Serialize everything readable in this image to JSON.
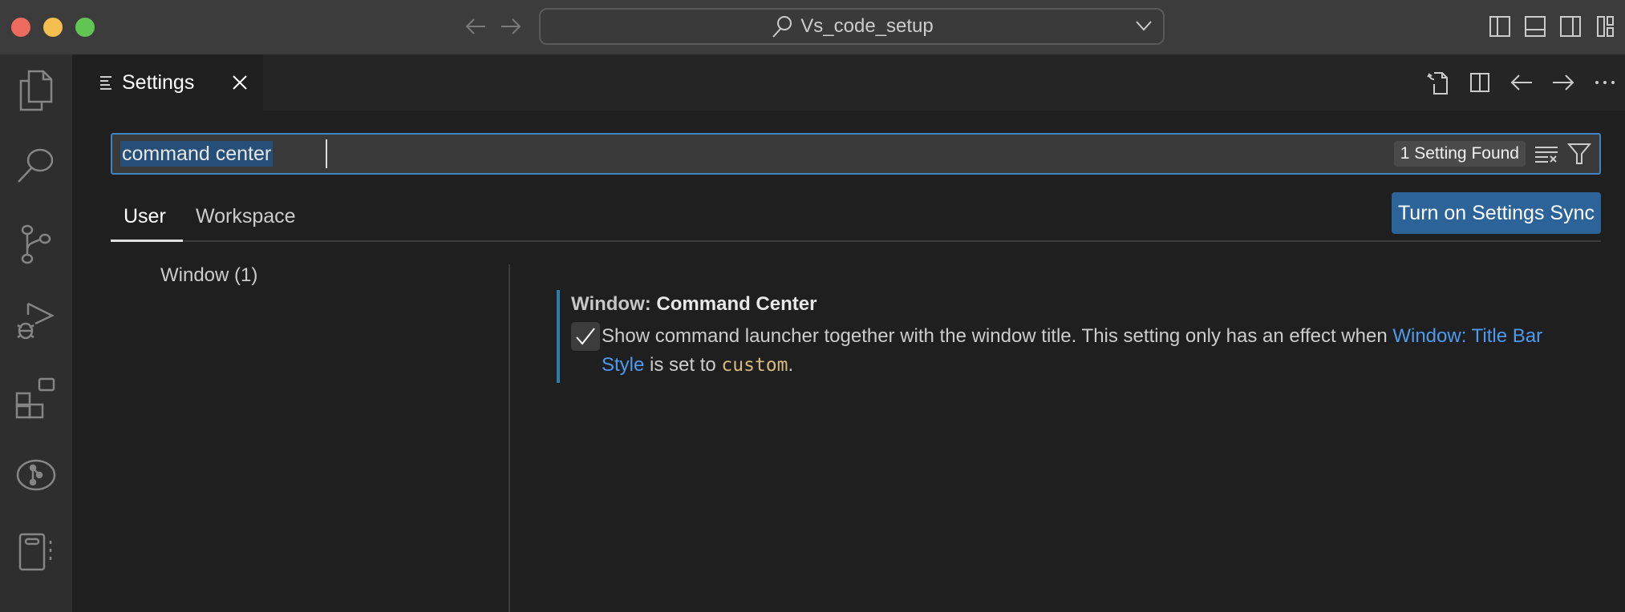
{
  "titlebar": {
    "window_controls": [
      "close",
      "minimize",
      "maximize"
    ],
    "back_icon": "arrow-left-icon",
    "forward_icon": "arrow-right-icon",
    "command_center_label": "Vs_code_setup",
    "layout_icons": [
      "toggle-primary-sidebar-icon",
      "toggle-panel-icon",
      "toggle-secondary-sidebar-icon",
      "customize-layout-icon"
    ]
  },
  "activity_bar": {
    "items": [
      {
        "name": "explorer",
        "icon": "files-icon"
      },
      {
        "name": "search",
        "icon": "search-icon"
      },
      {
        "name": "source-control",
        "icon": "source-control-icon"
      },
      {
        "name": "run-and-debug",
        "icon": "debug-icon"
      },
      {
        "name": "extensions",
        "icon": "extensions-icon"
      },
      {
        "name": "git-graph",
        "icon": "git-graph-icon"
      },
      {
        "name": "notebook",
        "icon": "notebook-icon"
      }
    ]
  },
  "editor": {
    "tab": {
      "label": "Settings",
      "icon": "settings-list-icon"
    },
    "actions": [
      "open-settings-json-icon",
      "split-editor-icon",
      "go-back-icon",
      "go-forward-icon",
      "more-actions-icon"
    ]
  },
  "settings": {
    "search": {
      "value": "command center",
      "result_count": "1 Setting Found",
      "clear_filter_icon": "clear-filter-icon",
      "filter_icon": "filter-icon"
    },
    "scope_tabs": [
      {
        "label": "User",
        "active": true
      },
      {
        "label": "Workspace",
        "active": false
      }
    ],
    "sync_button": "Turn on Settings Sync",
    "toc": [
      {
        "label": "Window (1)"
      }
    ],
    "items": [
      {
        "category": "Window: ",
        "title": "Command Center",
        "checked": true,
        "description_before": "Show command launcher together with the window title. This setting only has an effect when ",
        "link_text": "Window: Title Bar Style",
        "description_middle": " is set to ",
        "code_value": "custom",
        "description_after": "."
      }
    ]
  },
  "colors": {
    "accent_border": "#3d84c6",
    "sync_button": "#2c6399",
    "modified_bar": "#2d7bab",
    "link": "#4d9aef",
    "code": "#d7ba7d"
  }
}
